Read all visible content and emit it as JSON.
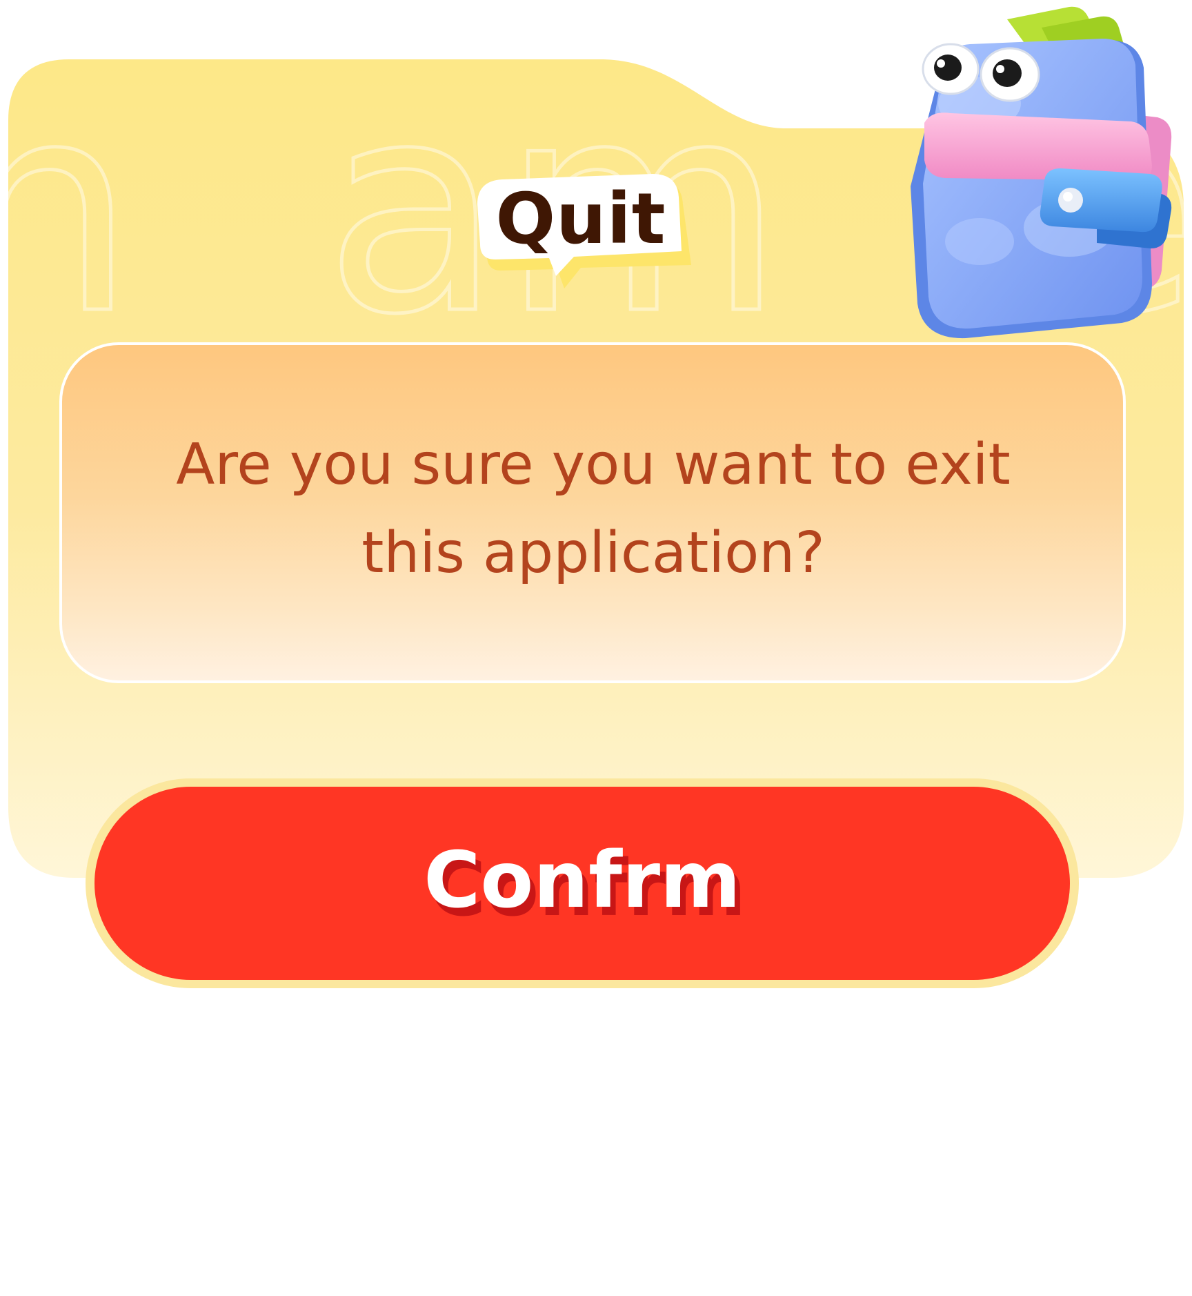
{
  "dialog": {
    "title": "Quit",
    "message": "Are you sure you want to exit this application?",
    "confirm_label": "Confrm"
  },
  "mascot": {
    "icon": "wallet-mascot-icon"
  },
  "colors": {
    "panel_top": "#fde888",
    "panel_bottom": "#fff5d0",
    "card_top": "#fec77f",
    "card_bottom": "#fff1e1",
    "message_text": "#b3431d",
    "title_text": "#3f1704",
    "confirm_button": "#ff3624",
    "confirm_border": "#fbe79e",
    "confirm_text": "#ffffff"
  }
}
